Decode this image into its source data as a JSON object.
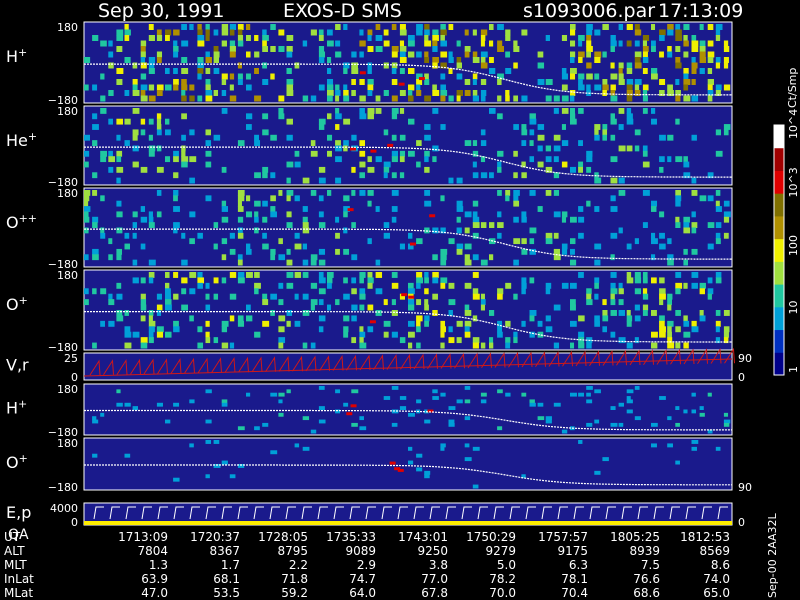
{
  "header": {
    "date": "Sep 30, 1991",
    "instrument": "EXOS-D SMS",
    "file": "s1093006.par",
    "time": "17:13:09"
  },
  "colorbar": {
    "label": "Ct/Smp",
    "ticks": [
      "1",
      "10",
      "100",
      "10^3",
      "10^4"
    ],
    "colors": [
      "#00008a",
      "#0030c0",
      "#00a0d8",
      "#20c8a0",
      "#a0e040",
      "#f0f000",
      "#b09000",
      "#807000",
      "#e00000",
      "#a00000",
      "#ffffff"
    ]
  },
  "colors": {
    "background": "#000000",
    "panel_fill": "#1a1a8c",
    "trace": "#ffffff",
    "velocity": "#d01818",
    "qa": "#ffee00"
  },
  "side_text": "Sep-00  2AA32L",
  "chart_data": {
    "type": "heatmap",
    "panels": [
      {
        "label": "H",
        "sup": "+",
        "ymax": "180",
        "ymin": "−180",
        "activity": 1.0,
        "xlim_trace": [
          0.62,
          0.74
        ]
      },
      {
        "label": "He",
        "sup": "+",
        "ymax": "180",
        "ymin": "−180",
        "activity": 0.55,
        "xlim_trace": [
          0.62,
          0.74
        ]
      },
      {
        "label": "O",
        "sup": "++",
        "ymax": "180",
        "ymin": "−180",
        "activity": 0.5,
        "xlim_trace": [
          0.62,
          0.74
        ]
      },
      {
        "label": "O",
        "sup": "+",
        "ymax": "180",
        "ymin": "−180",
        "activity": 0.7,
        "xlim_trace": [
          0.62,
          0.74
        ]
      },
      {
        "label": "V,r",
        "sup": "",
        "ymax": "25",
        "ymin": "0",
        "right_top": "90",
        "right_bottom": "0",
        "kind": "velocity"
      },
      {
        "label": "H",
        "sup": "+",
        "ymax": "180",
        "ymin": "−180",
        "activity": 0.25,
        "xlim_trace": [
          0.62,
          0.74
        ]
      },
      {
        "label": "O",
        "sup": "+",
        "ymax": "180",
        "ymin": "−180",
        "right_bottom": "90",
        "activity": 0.05,
        "xlim_trace": [
          0.62,
          0.74
        ]
      },
      {
        "label": "E,p",
        "label2": "QA",
        "sup": "",
        "ymax": "4000",
        "ymin": "0",
        "right_bottom": "0",
        "kind": "ep"
      }
    ],
    "table": {
      "rows": [
        {
          "name": "UT",
          "values": [
            "1713:09",
            "1720:37",
            "1728:05",
            "1735:33",
            "1743:01",
            "1750:29",
            "1757:57",
            "1805:25",
            "1812:53"
          ]
        },
        {
          "name": "ALT",
          "values": [
            "7804",
            "8367",
            "8795",
            "9089",
            "9250",
            "9279",
            "9175",
            "8939",
            "8569"
          ]
        },
        {
          "name": "MLT",
          "values": [
            "1.3",
            "1.7",
            "2.2",
            "2.9",
            "3.8",
            "5.0",
            "6.3",
            "7.5",
            "8.6"
          ]
        },
        {
          "name": "InLat",
          "values": [
            "63.9",
            "68.1",
            "71.8",
            "74.7",
            "77.0",
            "78.2",
            "78.1",
            "76.6",
            "74.0"
          ]
        },
        {
          "name": "MLat",
          "values": [
            "47.0",
            "53.5",
            "59.2",
            "64.0",
            "67.8",
            "70.0",
            "70.4",
            "68.6",
            "65.0"
          ]
        }
      ]
    }
  }
}
